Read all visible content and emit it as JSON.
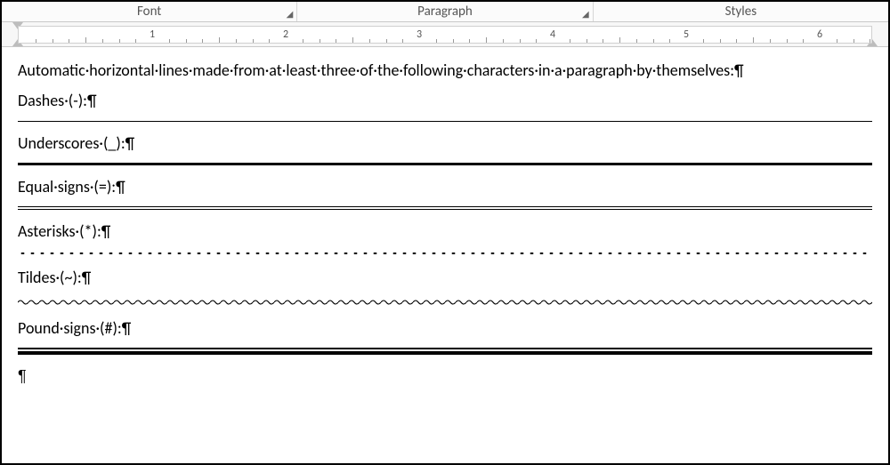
{
  "ribbon": {
    "font_label": "Font",
    "paragraph_label": "Paragraph",
    "styles_label": "Styles"
  },
  "ruler": {
    "labels": [
      "1",
      "2",
      "3",
      "4",
      "5",
      "6"
    ]
  },
  "paragraphs": {
    "intro": "Automatic·horizontal·lines·made·from·at·least·three·of·the·following·characters·in·a·paragraph·by·themselves:¶",
    "dashes": "Dashes·(-):¶",
    "underscores": "Underscores·(_):¶",
    "equals": "Equal·signs·(=):¶",
    "asterisks": "Asterisks·(*):¶",
    "tildes": "Tildes·(~):¶",
    "pounds": "Pound·signs·(#):¶",
    "empty": "¶"
  }
}
